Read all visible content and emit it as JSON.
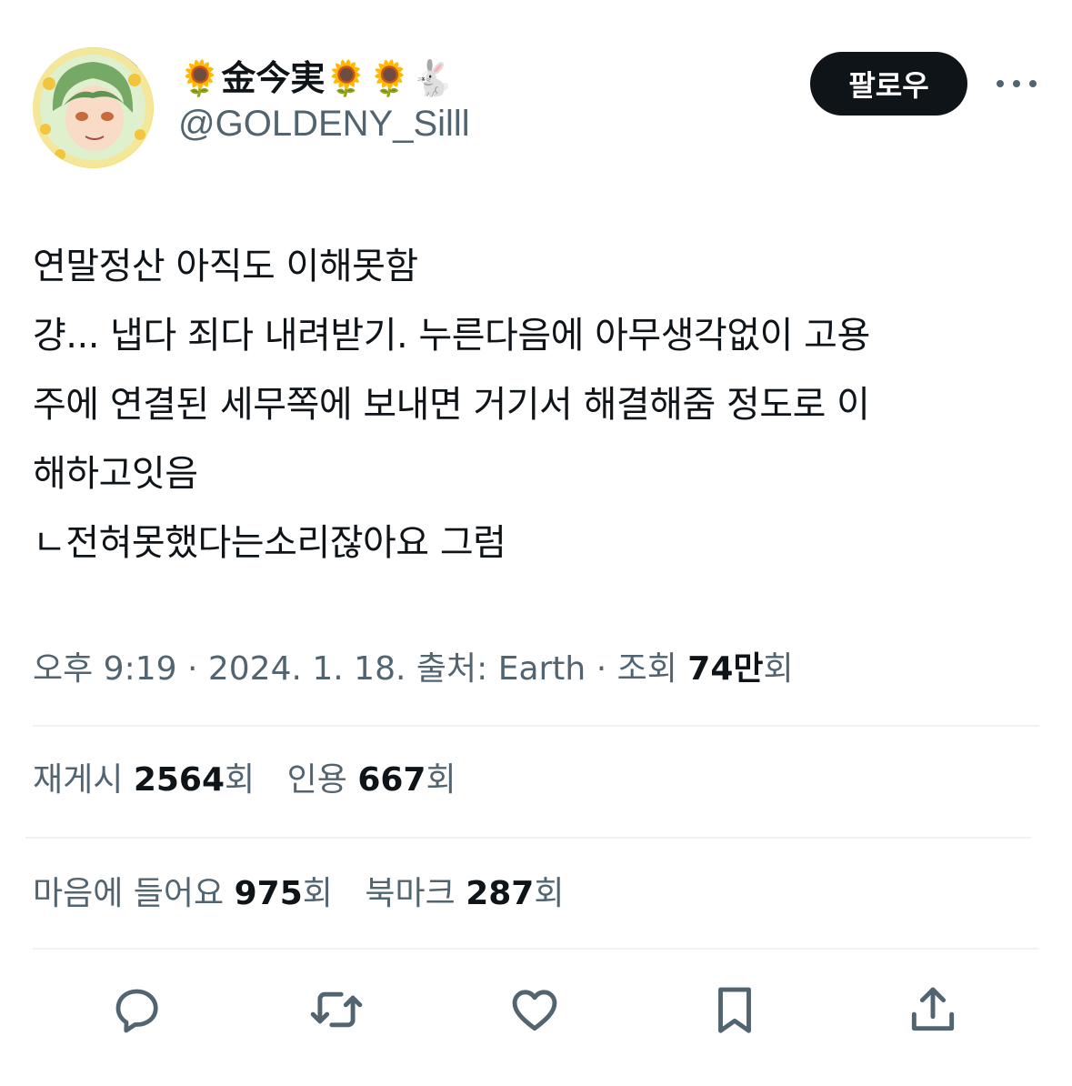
{
  "user": {
    "display_name": "🌻金今実🌻🌻🐇",
    "handle": "@GOLDENY_Silll"
  },
  "follow_label": "팔로우",
  "tweet": {
    "lines": [
      "연말정산 아직도 이해못함",
      "걍... 냅다 죄다 내려받기. 누른다음에 아무생각없이 고용",
      "주에 연결된 세무쪽에 보내면 거기서 해결해줌 정도로 이",
      "해하고잇음",
      " ㄴ전혀못했다는소리잖아요 그럼"
    ]
  },
  "meta": {
    "time": "오후 9:19",
    "date": "2024. 1. 18.",
    "source_label": "출처:",
    "source": "Earth",
    "views_label": "조회",
    "views_count": "74만",
    "views_suffix": "회"
  },
  "stats": {
    "retweets_label": "재게시",
    "retweets": "2564",
    "quotes_label": "인용",
    "quotes": "667",
    "likes_label": "마음에 들어요",
    "likes": "975",
    "bookmarks_label": "북마크",
    "bookmarks": "287",
    "unit": "회"
  },
  "action_icons": [
    "reply-icon",
    "retweet-icon",
    "like-icon",
    "bookmark-icon",
    "share-icon"
  ],
  "colors": {
    "text": "#0f1419",
    "secondary": "#536471",
    "divider": "#eff3f4",
    "button_bg": "#0f1419"
  }
}
